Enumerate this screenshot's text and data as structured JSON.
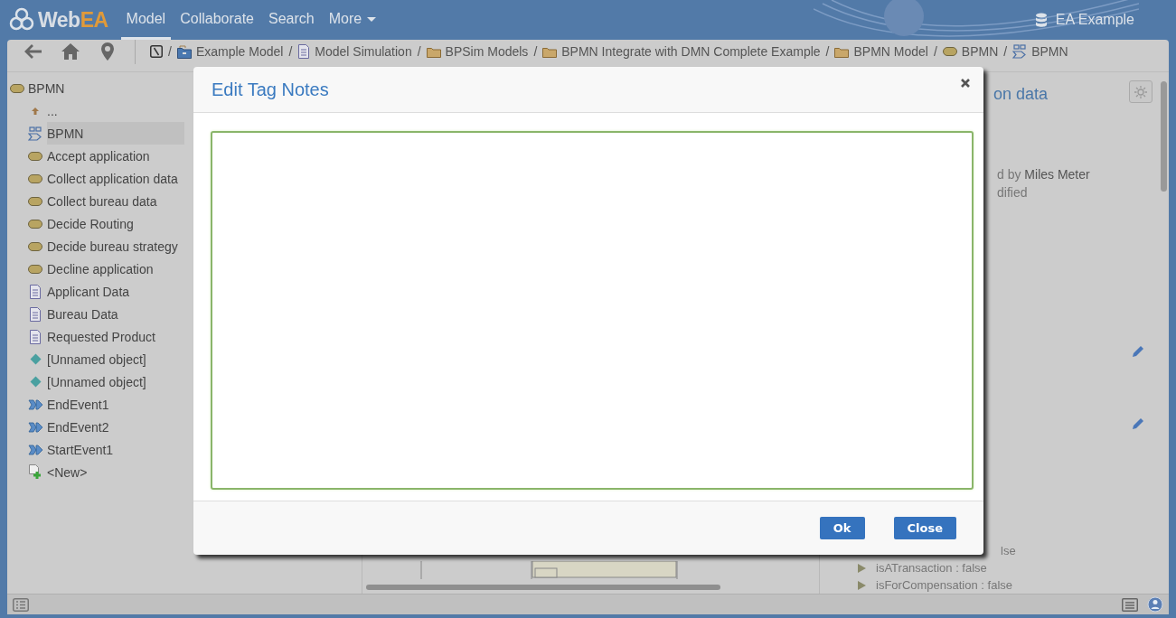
{
  "header": {
    "logo": {
      "text": "Web",
      "accent": "EA"
    },
    "nav": [
      {
        "label": "Model",
        "selected": true,
        "kind": "link"
      },
      {
        "label": "Collaborate",
        "selected": false,
        "kind": "link"
      },
      {
        "label": "Search",
        "selected": false,
        "kind": "link"
      },
      {
        "label": "More",
        "selected": false,
        "kind": "dropdown"
      }
    ],
    "repository": "EA Example"
  },
  "breadcrumbs": [
    {
      "separator": "/",
      "label": "Example Model",
      "kind": "model"
    },
    {
      "separator": "/",
      "label": "Model Simulation",
      "kind": "document"
    },
    {
      "separator": "/",
      "label": "BPSim Models",
      "kind": "folder"
    },
    {
      "separator": "/",
      "label": "BPMN Integrate with DMN Complete Example",
      "kind": "folder"
    },
    {
      "separator": "/",
      "label": "BPMN Model",
      "kind": "folder"
    },
    {
      "separator": "/",
      "label": "BPMN",
      "kind": "activity"
    },
    {
      "separator": "/",
      "label": "BPMN",
      "kind": "diagram"
    }
  ],
  "tree": {
    "label": "BPMN",
    "kind": "activity",
    "children": [
      {
        "label": "...",
        "kind": "up",
        "selected": false
      },
      {
        "label": "BPMN",
        "kind": "diagram",
        "selected": true
      },
      {
        "label": "Accept application",
        "kind": "activity",
        "selected": false
      },
      {
        "label": "Collect application data",
        "kind": "activity",
        "selected": false
      },
      {
        "label": "Collect bureau data",
        "kind": "activity",
        "selected": false
      },
      {
        "label": "Decide Routing",
        "kind": "activity",
        "selected": false
      },
      {
        "label": "Decide bureau strategy",
        "kind": "activity",
        "selected": false
      },
      {
        "label": "Decline application",
        "kind": "activity",
        "selected": false
      },
      {
        "label": "Applicant Data",
        "kind": "document",
        "selected": false
      },
      {
        "label": "Bureau Data",
        "kind": "document",
        "selected": false
      },
      {
        "label": "Requested Product",
        "kind": "document",
        "selected": false
      },
      {
        "label": "[Unnamed object]",
        "kind": "gateway",
        "selected": false
      },
      {
        "label": "[Unnamed object]",
        "kind": "gateway",
        "selected": false
      },
      {
        "label": "EndEvent1",
        "kind": "event",
        "selected": false
      },
      {
        "label": "EndEvent2",
        "kind": "event",
        "selected": false
      },
      {
        "label": "StartEvent1",
        "kind": "event",
        "selected": false
      },
      {
        "label": "<New>",
        "kind": "new",
        "selected": false
      }
    ]
  },
  "properties_panel": {
    "title": "on data",
    "author_prefix": "d by",
    "author": "Miles Meter",
    "modified": "dified",
    "properties": [
      {
        "text": "lse",
        "kind": "hidden_icon"
      },
      {
        "text": "isATransaction : false",
        "kind": "flag"
      },
      {
        "text": "isForCompensation : false",
        "kind": "flag"
      }
    ]
  },
  "dialog": {
    "title": "Edit Tag Notes",
    "buttons": [
      "Ok",
      "Close"
    ]
  }
}
